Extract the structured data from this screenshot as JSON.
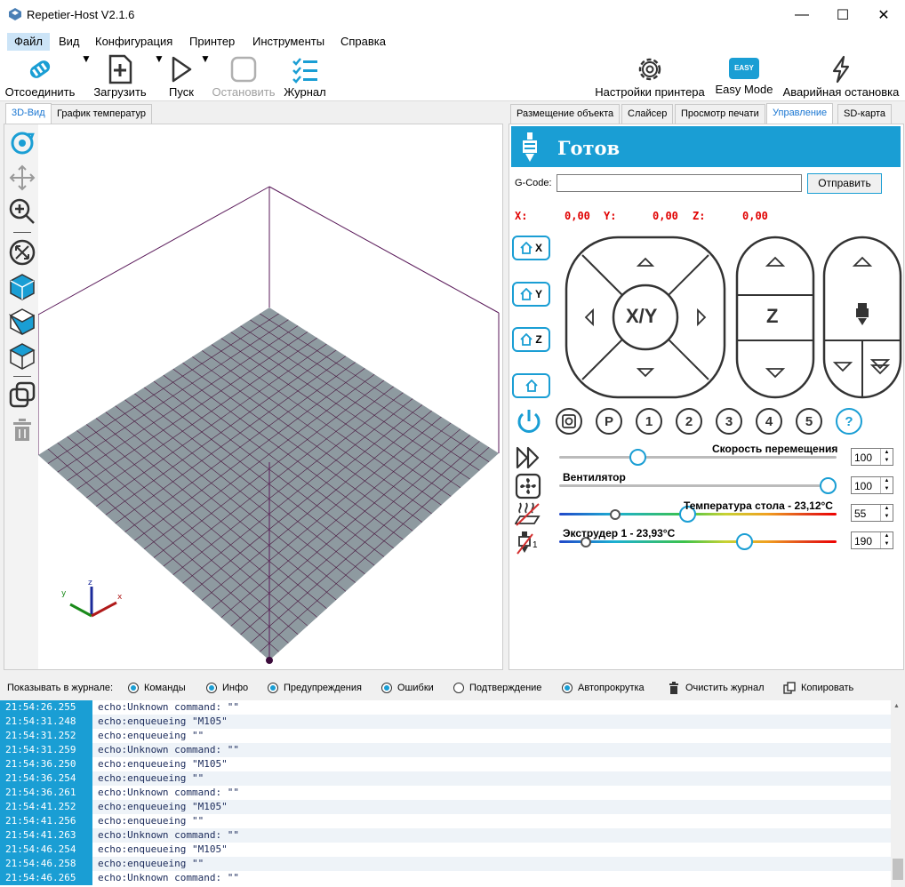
{
  "window": {
    "title": "Repetier-Host V2.1.6",
    "minimize": "—",
    "maximize": "☐",
    "close": "✕"
  },
  "menu": [
    "Файл",
    "Вид",
    "Конфигурация",
    "Принтер",
    "Инструменты",
    "Справка"
  ],
  "toolbar": {
    "disconnect": "Отсоединить",
    "load": "Загрузить",
    "run": "Пуск",
    "stop": "Остановить",
    "log": "Журнал",
    "printer_settings": "Настройки принтера",
    "easy_mode": "Easy Mode",
    "easy_badge": "EASY",
    "emergency_stop": "Аварийная остановка"
  },
  "left_tabs": [
    "3D-Вид",
    "График температур"
  ],
  "right_tabs": [
    "Размещение объекта",
    "Слайсер",
    "Просмотр печати",
    "Управление",
    "SD-карта"
  ],
  "control": {
    "status": "Готов",
    "gcode_label": "G-Code:",
    "gcode_value": "",
    "send": "Отправить",
    "x_label": "X:",
    "x_value": "0,00",
    "y_label": "Y:",
    "y_value": "0,00",
    "z_label": "Z:",
    "z_value": "0,00",
    "home_x": "X",
    "home_y": "Y",
    "home_z": "Z",
    "xy_label": "X/Y",
    "z_pad_label": "Z",
    "circle_buttons": [
      "P",
      "1",
      "2",
      "3",
      "4",
      "5",
      "?"
    ],
    "speed_label": "Скорость перемещения",
    "speed_value": "100",
    "speed_fraction": 0.27,
    "fan_label": "Вентилятор",
    "fan_value": "100",
    "fan_fraction": 1.0,
    "bed_label": "Температура стола - 23,12°C",
    "bed_value": "55",
    "bed_current_fraction": 0.19,
    "bed_target_fraction": 0.46,
    "extruder_label": "Экструдер 1 - 23,93°C",
    "extruder_value": "190",
    "extruder_current_fraction": 0.08,
    "extruder_target_fraction": 0.68,
    "extruder_index": "1"
  },
  "log_options": {
    "show_label": "Показывать в журнале:",
    "items": [
      {
        "label": "Команды",
        "checked": true
      },
      {
        "label": "Инфо",
        "checked": true
      },
      {
        "label": "Предупреждения",
        "checked": true
      },
      {
        "label": "Ошибки",
        "checked": true
      },
      {
        "label": "Подтверждение",
        "checked": false
      },
      {
        "label": "Автопрокрутка",
        "checked": true
      }
    ],
    "clear": "Очистить журнал",
    "copy": "Копировать"
  },
  "log": [
    {
      "time": "21:54:26.255",
      "msg": "echo:Unknown command: \"\""
    },
    {
      "time": "21:54:31.248",
      "msg": "echo:enqueueing \"M105\""
    },
    {
      "time": "21:54:31.252",
      "msg": "echo:enqueueing \"\""
    },
    {
      "time": "21:54:31.259",
      "msg": "echo:Unknown command: \"\""
    },
    {
      "time": "21:54:36.250",
      "msg": "echo:enqueueing \"M105\""
    },
    {
      "time": "21:54:36.254",
      "msg": "echo:enqueueing \"\""
    },
    {
      "time": "21:54:36.261",
      "msg": "echo:Unknown command: \"\""
    },
    {
      "time": "21:54:41.252",
      "msg": "echo:enqueueing \"M105\""
    },
    {
      "time": "21:54:41.256",
      "msg": "echo:enqueueing \"\""
    },
    {
      "time": "21:54:41.263",
      "msg": "echo:Unknown command: \"\""
    },
    {
      "time": "21:54:46.254",
      "msg": "echo:enqueueing \"M105\""
    },
    {
      "time": "21:54:46.258",
      "msg": "echo:enqueueing \"\""
    },
    {
      "time": "21:54:46.265",
      "msg": "echo:Unknown command: \"\""
    }
  ],
  "colors": {
    "accent": "#1a9ed4",
    "coord_red": "#e00000",
    "bed_fill": "#8e9aa0",
    "bed_grid": "#4a1840",
    "frame": "#5a1a5a"
  }
}
